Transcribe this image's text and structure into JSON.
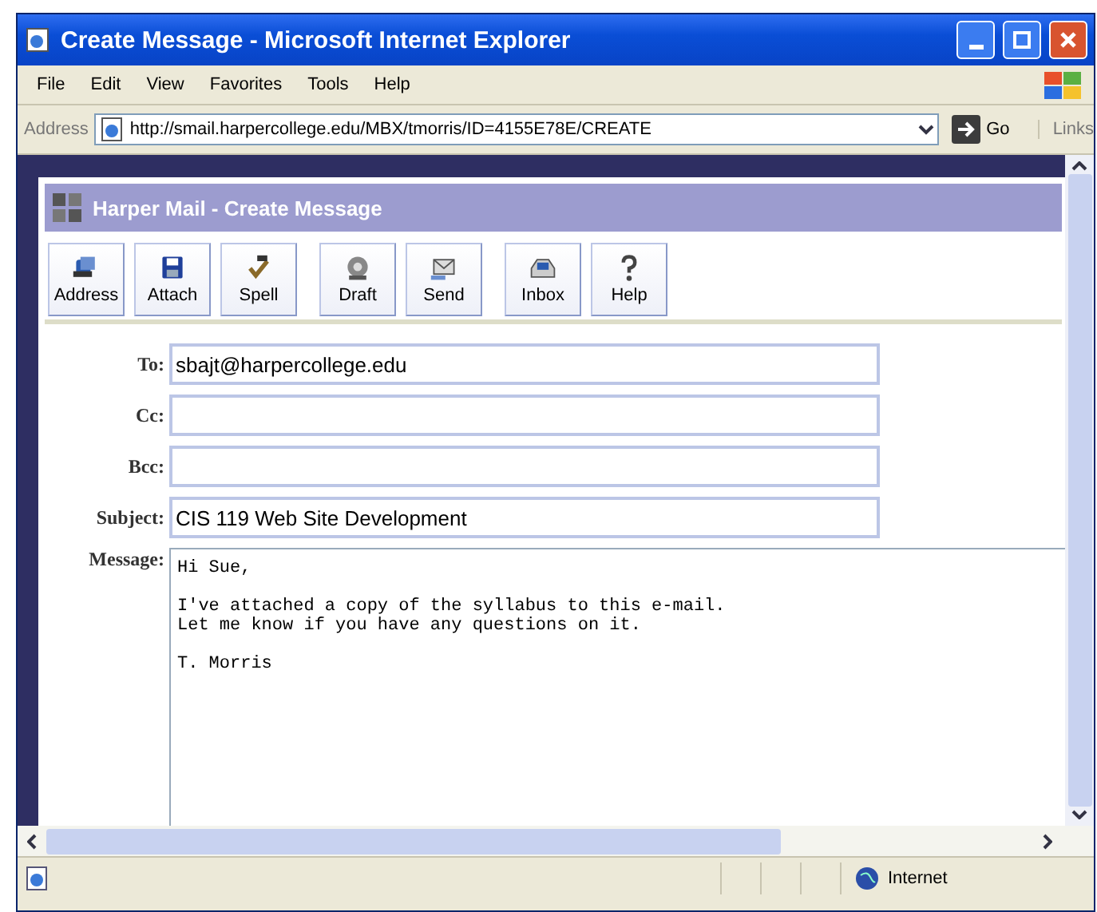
{
  "window": {
    "title": "Create Message - Microsoft Internet Explorer"
  },
  "menu": [
    "File",
    "Edit",
    "View",
    "Favorites",
    "Tools",
    "Help"
  ],
  "address_bar": {
    "label": "Address",
    "url": "http://smail.harpercollege.edu/MBX/tmorris/ID=4155E78E/CREATE",
    "go": "Go",
    "links": "Links"
  },
  "page": {
    "title": "Harper Mail - Create Message",
    "toolbar": [
      [
        "Address",
        "Attach",
        "Spell"
      ],
      [
        "Draft",
        "Send"
      ],
      [
        "Inbox",
        "Help"
      ]
    ],
    "fields": [
      {
        "label": "To:",
        "value": "sbajt@harpercollege.edu"
      },
      {
        "label": "Cc:"
      },
      {
        "label": "Bcc:"
      },
      {
        "label": "Subject:",
        "value": "CIS 119 Web Site Development"
      }
    ],
    "message": {
      "label": "Message:",
      "value": "Hi Sue,\n\nI've attached a copy of the syllabus to this e-mail.\nLet me know if you have any questions on it.\n\nT. Morris"
    }
  },
  "status_bar": {
    "zone": "Internet"
  }
}
